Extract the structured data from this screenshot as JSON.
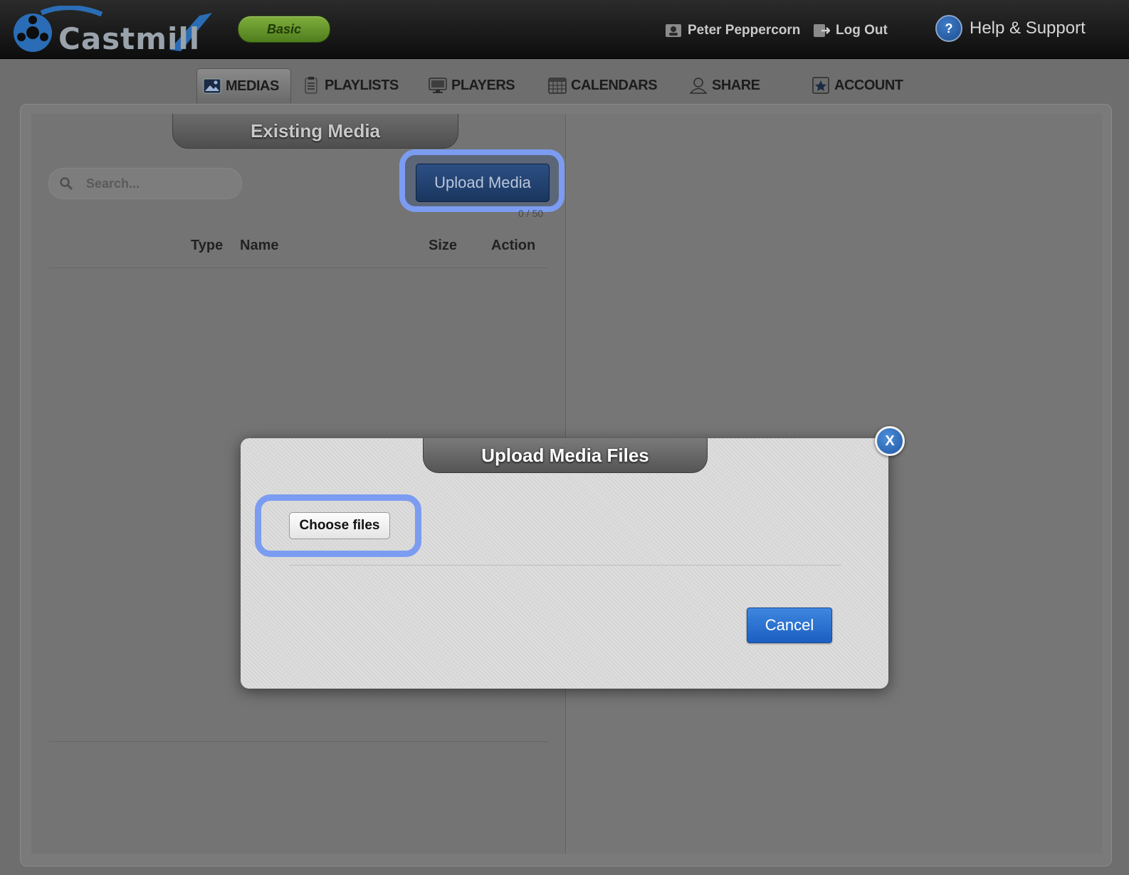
{
  "header": {
    "logo_text": "Castmill",
    "plan_badge": "Basic",
    "user_name": "Peter Peppercorn",
    "logout_label": "Log Out",
    "help_label": "Help & Support",
    "help_glyph": "?"
  },
  "nav": {
    "tabs": [
      {
        "label": "MEDIAS",
        "icon": "image-icon",
        "active": true
      },
      {
        "label": "PLAYLISTS",
        "icon": "clipboard-icon",
        "active": false
      },
      {
        "label": "PLAYERS",
        "icon": "monitor-icon",
        "active": false
      },
      {
        "label": "CALENDARS",
        "icon": "calendar-icon",
        "active": false
      },
      {
        "label": "SHARE",
        "icon": "user-share-icon",
        "active": false
      },
      {
        "label": "ACCOUNT",
        "icon": "star-badge-icon",
        "active": false
      }
    ]
  },
  "media": {
    "section_title": "Existing Media",
    "search_placeholder": "Search...",
    "upload_button": "Upload Media",
    "quota": "0 / 50",
    "columns": [
      "Type",
      "Name",
      "Size",
      "Action"
    ]
  },
  "modal": {
    "title": "Upload Media Files",
    "close_label": "X",
    "choose_files": "Choose files",
    "cancel": "Cancel"
  },
  "colors": {
    "highlight": "#7b9cf1",
    "cancel_blue": "#1b5fc2",
    "plan_green": "#5f8f25"
  }
}
